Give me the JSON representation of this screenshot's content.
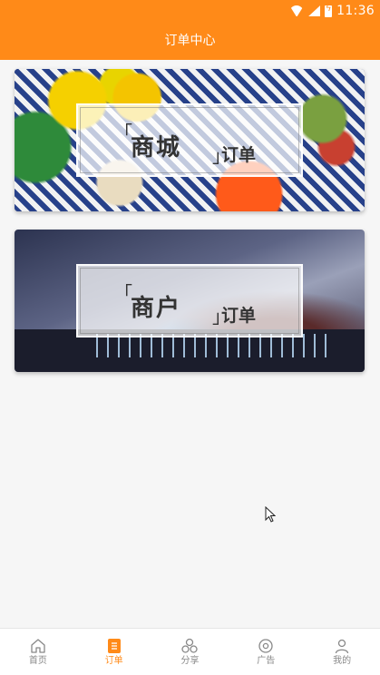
{
  "status_bar": {
    "time": "11:36",
    "icons": [
      "wifi-icon",
      "signal-icon",
      "battery-charging-icon"
    ]
  },
  "header": {
    "title": "订单中心"
  },
  "cards": [
    {
      "id": "mall",
      "bracket_open": "「",
      "bracket_close": "」",
      "main": "商城",
      "sub": "订单"
    },
    {
      "id": "merchant",
      "bracket_open": "「",
      "bracket_close": "」",
      "main": "商户",
      "sub": "订单"
    }
  ],
  "bottom_nav": {
    "items": [
      {
        "label": "首页",
        "icon": "home-icon",
        "active": false
      },
      {
        "label": "订单",
        "icon": "order-icon",
        "active": true
      },
      {
        "label": "分享",
        "icon": "share-icon",
        "active": false
      },
      {
        "label": "广告",
        "icon": "ad-icon",
        "active": false
      },
      {
        "label": "我的",
        "icon": "profile-icon",
        "active": false
      }
    ]
  },
  "colors": {
    "accent": "#ff8a18",
    "nav_inactive": "#888888",
    "background": "#f6f6f6"
  }
}
